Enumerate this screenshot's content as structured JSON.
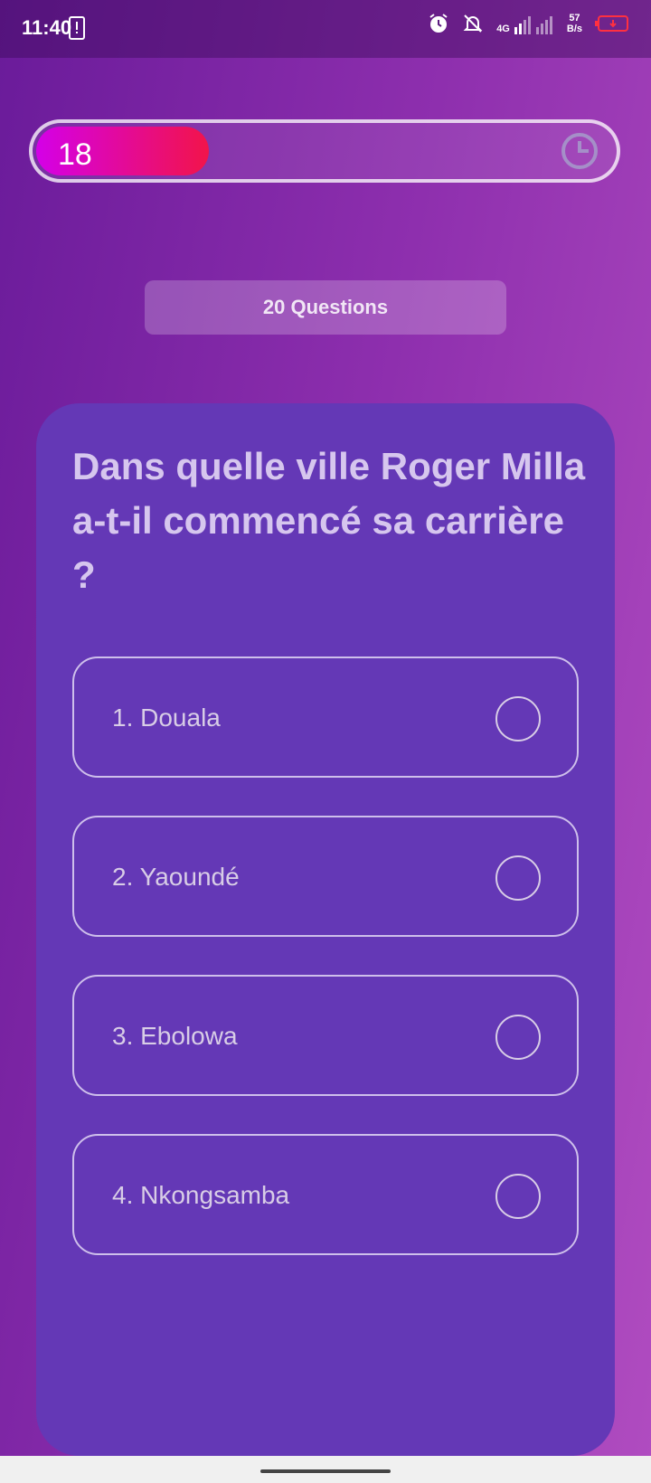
{
  "status_bar": {
    "time": "11:40",
    "network": "4G",
    "speed_value": "57",
    "speed_unit": "B/s",
    "icons": [
      "alert-phone-icon",
      "alarm-icon",
      "mute-icon",
      "signal-icon",
      "battery-icon"
    ]
  },
  "timer": {
    "value": "18",
    "progress": 0.3,
    "icon": "clock-icon"
  },
  "quiz": {
    "questions_label": "20 Questions",
    "question": "Dans quelle ville Roger Milla a-t-il commencé sa carrière ?",
    "options": [
      {
        "label": "1. Douala"
      },
      {
        "label": "2. Yaoundé"
      },
      {
        "label": "3. Ebolowa"
      },
      {
        "label": "4. Nkongsamba"
      }
    ]
  },
  "colors": {
    "accent_start": "#d400e8",
    "accent_end": "#f2144a",
    "card": "#6438b6"
  }
}
